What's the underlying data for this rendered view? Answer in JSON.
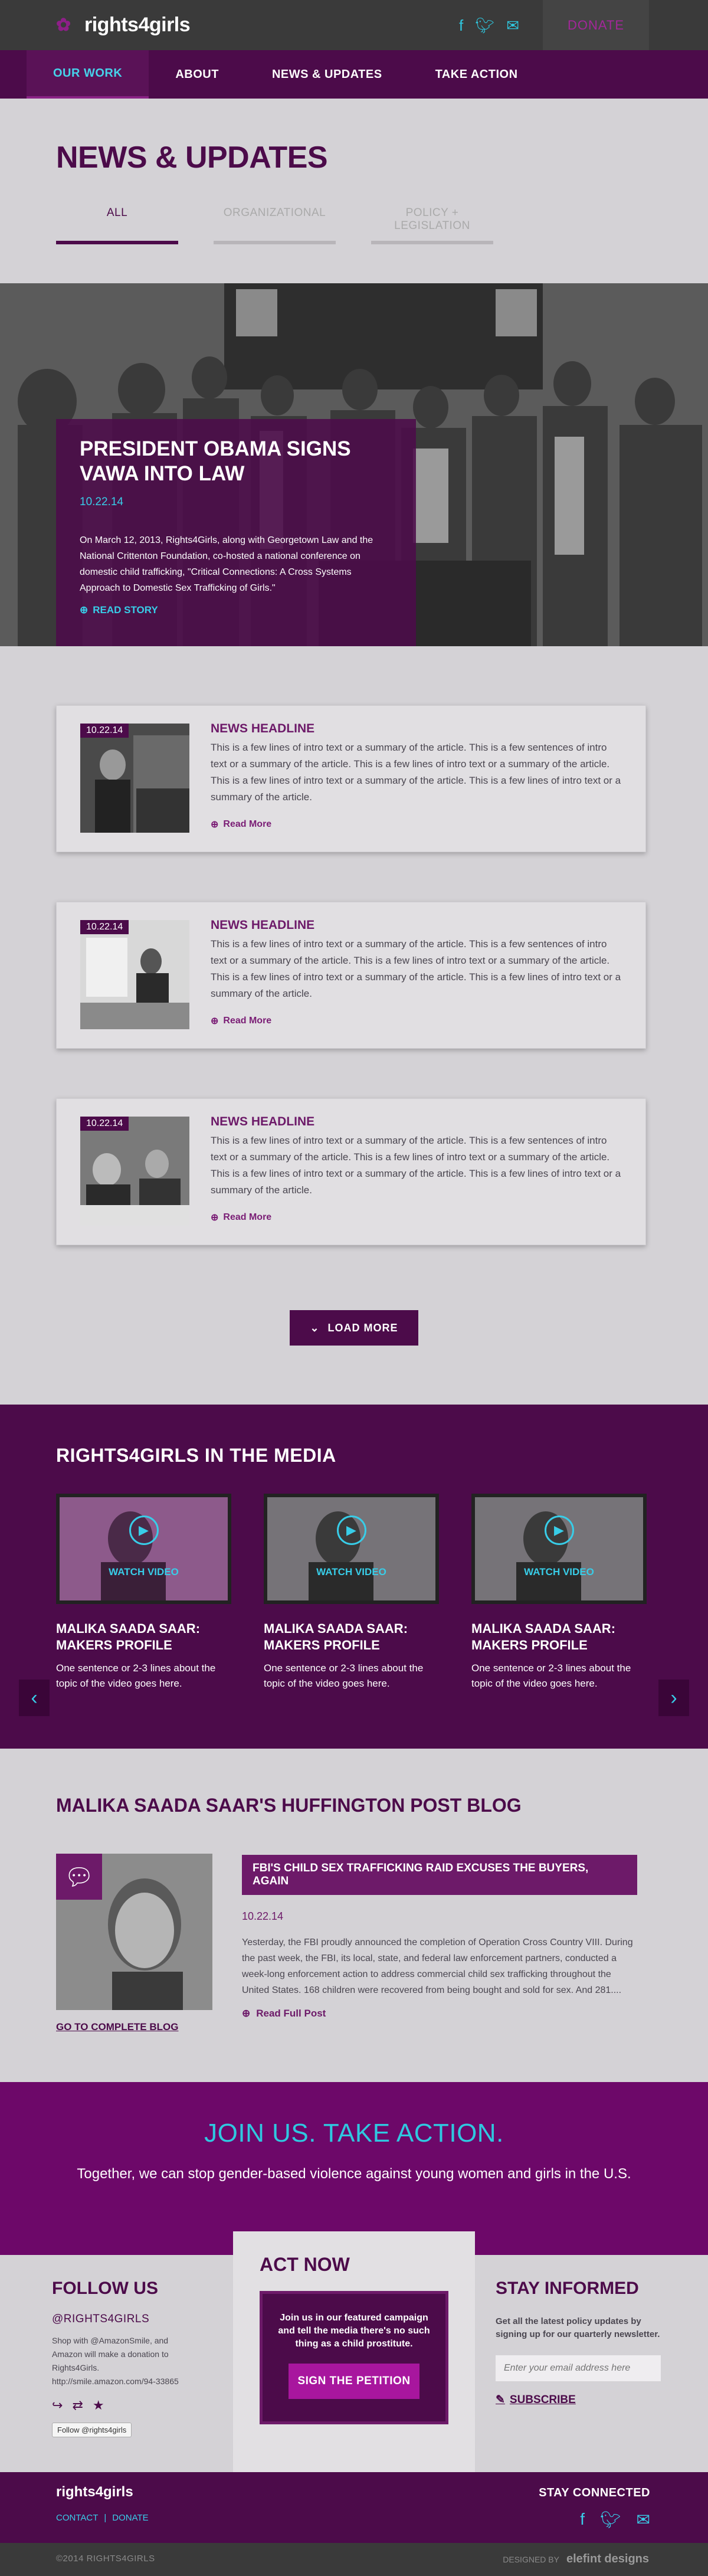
{
  "header": {
    "logo": "rights4girls",
    "social_icons": [
      "facebook-icon",
      "twitter-icon",
      "mail-icon"
    ],
    "donate_label": "DONATE"
  },
  "nav": {
    "items": [
      {
        "label": "OUR WORK",
        "active": true
      },
      {
        "label": "ABOUT",
        "active": false
      },
      {
        "label": "NEWS & UPDATES",
        "active": false
      },
      {
        "label": "TAKE ACTION",
        "active": false
      }
    ]
  },
  "news": {
    "title": "NEWS & UPDATES",
    "tabs": [
      "ALL",
      "ORGANIZATIONAL",
      "POLICY + LEGISLATION"
    ]
  },
  "hero": {
    "headline": "PRESIDENT OBAMA SIGNS VAWA INTO LAW",
    "date": "10.22.14",
    "text": "On March 12, 2013, Rights4Girls, along with Georgetown Law and the National Crittenton Foundation, co-hosted a national conference on domestic child trafficking, \"Critical Connections: A Cross Systems Approach to Domestic Sex Trafficking of Girls.\"",
    "link": "READ STORY"
  },
  "articles": [
    {
      "date": "10.22.14",
      "headline": "NEWS HEADLINE",
      "text": "This is a few lines of intro text or a summary of the article. This is a few sentences of intro text or a summary of the article. This is a few lines of intro text or a summary of the article. This is a few lines of intro text or a summary of the article. This is a few lines of intro text or a summary of the article.",
      "link": "Read More"
    },
    {
      "date": "10.22.14",
      "headline": "NEWS HEADLINE",
      "text": "This is a few lines of intro text or a summary of the article. This is a few sentences of intro text or a summary of the article. This is a few lines of intro text or a summary of the article. This is a few lines of intro text or a summary of the article. This is a few lines of intro text or a summary of the article.",
      "link": "Read More"
    },
    {
      "date": "10.22.14",
      "headline": "NEWS HEADLINE",
      "text": "This is a few lines of intro text or a summary of the article. This is a few sentences of intro text or a summary of the article. This is a few lines of intro text or a summary of the article. This is a few lines of intro text or a summary of the article. This is a few lines of intro text or a summary of the article.",
      "link": "Read More"
    }
  ],
  "load_more": "LOAD MORE",
  "media": {
    "title": "RIGHTS4GIRLS IN THE MEDIA",
    "videos": [
      {
        "watch": "WATCH VIDEO",
        "name": "MALIKA SAADA SAAR: MAKERS PROFILE",
        "desc": "One sentence or 2-3 lines about the topic of the video goes here."
      },
      {
        "watch": "WATCH VIDEO",
        "name": "MALIKA SAADA SAAR: MAKERS PROFILE",
        "desc": "One sentence or 2-3 lines about the topic of the video goes here."
      },
      {
        "watch": "WATCH VIDEO",
        "name": "MALIKA SAADA SAAR: MAKERS PROFILE",
        "desc": "One sentence or 2-3 lines about the topic of the video goes here."
      }
    ]
  },
  "blog": {
    "title": "MALIKA SAADA SAAR'S HUFFINGTON POST BLOG",
    "headline": "FBI'S CHILD SEX TRAFFICKING RAID EXCUSES THE BUYERS, AGAIN",
    "date": "10.22.14",
    "text": "Yesterday, the FBI proudly announced the completion of Operation Cross Country VIII. During the past week, the FBI, its local, state, and federal law enforcement partners, conducted a week-long enforcement action to address commercial child sex trafficking throughout the United States. 168 children were recovered from being bought and sold for sex. And 281....",
    "link": "Read Full Post",
    "complete_link": "GO TO COMPLETE BLOG"
  },
  "join": {
    "title": "JOIN US. TAKE ACTION.",
    "subtitle": "Together, we can stop gender-based violence against young women and girls in the U.S."
  },
  "follow": {
    "title": "FOLLOW US",
    "handle": "@RIGHTS4GIRLS",
    "smile_text": "Shop with @AmazonSmile, and Amazon will make a donation to Rights4Girls. http://smile.amazon.com/94-33865",
    "follow_btn": "Follow @rights4girls"
  },
  "act": {
    "title": "ACT NOW",
    "text": "Join us in our featured campaign and tell the media there's no such thing as a child prostitute.",
    "button": "SIGN THE PETITION"
  },
  "stay": {
    "title": "STAY INFORMED",
    "text": "Get all the latest policy updates by signing up for our quarterly newsletter.",
    "placeholder": "Enter your email address here",
    "subscribe": "SUBSCRIBE"
  },
  "footer": {
    "logo": "rights4girls",
    "links": [
      "CONTACT",
      "|",
      "DONATE"
    ],
    "stay_connected": "STAY CONNECTED",
    "copyright": "©2014 RIGHTS4GIRLS",
    "designed_by": "DESIGNED BY",
    "designer": "elefint designs"
  },
  "colors": {
    "purple": "#4c0b4a",
    "magenta": "#6d0869",
    "cyan": "#2fc8e0"
  }
}
